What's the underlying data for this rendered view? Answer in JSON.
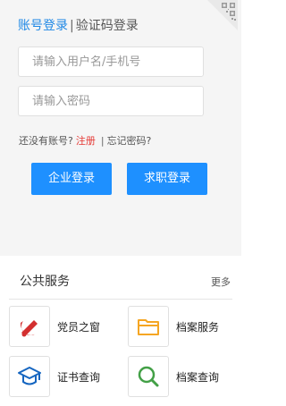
{
  "login": {
    "tab_account": "账号登录",
    "tab_separator": "|",
    "tab_code": "验证码登录",
    "username_placeholder": "请输入用户名/手机号",
    "password_placeholder": "请输入密码",
    "no_account_text": "还没有账号?",
    "register_link": "注册",
    "link_separator": "|",
    "forgot_link": "忘记密码?",
    "enterprise_login_button": "企业登录",
    "jobseeker_login_button": "求职登录",
    "qr_icon": "qr-code-corner-icon",
    "accent_color": "#1e88e5",
    "register_color": "#e53935"
  },
  "services": {
    "title": "公共服务",
    "more": "更多",
    "items": [
      {
        "label": "党员之窗",
        "icon": "party-emblem-icon",
        "color": "#d32f2f"
      },
      {
        "label": "档案服务",
        "icon": "folder-icon",
        "color": "#f5a623"
      },
      {
        "label": "证书查询",
        "icon": "graduation-cap-icon",
        "color": "#1565c0"
      },
      {
        "label": "档案查询",
        "icon": "magnifier-icon",
        "color": "#43a047"
      }
    ]
  }
}
